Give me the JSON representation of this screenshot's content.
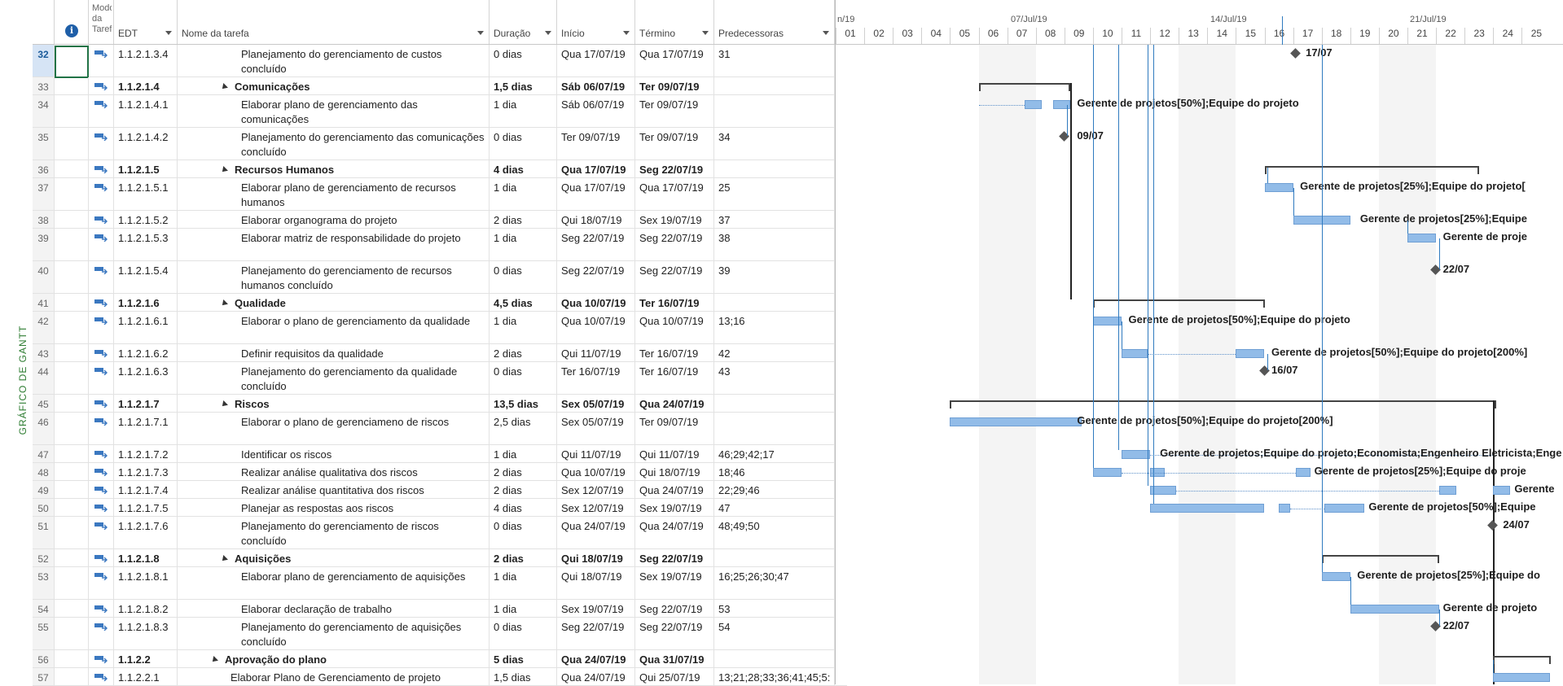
{
  "side_label": "GRÁFICO DE GANTT",
  "columns": {
    "info": "i",
    "mode": "Modo da Tarefa",
    "edt": "EDT",
    "name": "Nome da tarefa",
    "duration": "Duração",
    "start": "Início",
    "finish": "Término",
    "pred": "Predecessoras"
  },
  "rows": [
    {
      "id": "32",
      "edt": "1.1.2.1.3.4",
      "name": "Planejamento do gerenciamento de custos concluído",
      "dur": "0 dias",
      "start": "Qua 17/07/19",
      "finish": "Qua 17/07/19",
      "pred": "31",
      "summary": false,
      "selected": true
    },
    {
      "id": "33",
      "edt": "1.1.2.1.4",
      "name": "Comunicações",
      "dur": "1,5 dias",
      "start": "Sáb 06/07/19",
      "finish": "Ter 09/07/19",
      "pred": "",
      "summary": true
    },
    {
      "id": "34",
      "edt": "1.1.2.1.4.1",
      "name": "Elaborar plano de gerenciamento das comunicações",
      "dur": "1 dia",
      "start": "Sáb 06/07/19",
      "finish": "Ter 09/07/19",
      "pred": "",
      "summary": false
    },
    {
      "id": "35",
      "edt": "1.1.2.1.4.2",
      "name": "Planejamento do gerenciamento das comunicações concluído",
      "dur": "0 dias",
      "start": "Ter 09/07/19",
      "finish": "Ter 09/07/19",
      "pred": "34",
      "summary": false
    },
    {
      "id": "36",
      "edt": "1.1.2.1.5",
      "name": "Recursos Humanos",
      "dur": "4 dias",
      "start": "Qua 17/07/19",
      "finish": "Seg 22/07/19",
      "pred": "",
      "summary": true
    },
    {
      "id": "37",
      "edt": "1.1.2.1.5.1",
      "name": "Elaborar plano de gerenciamento de recursos humanos",
      "dur": "1 dia",
      "start": "Qua 17/07/19",
      "finish": "Qua 17/07/19",
      "pred": "25",
      "summary": false
    },
    {
      "id": "38",
      "edt": "1.1.2.1.5.2",
      "name": "Elaborar organograma do projeto",
      "dur": "2 dias",
      "start": "Qui 18/07/19",
      "finish": "Sex 19/07/19",
      "pred": "37",
      "summary": false
    },
    {
      "id": "39",
      "edt": "1.1.2.1.5.3",
      "name": "Elaborar matriz de responsabilidade do projeto",
      "dur": "1 dia",
      "start": "Seg 22/07/19",
      "finish": "Seg 22/07/19",
      "pred": "38",
      "summary": false
    },
    {
      "id": "40",
      "edt": "1.1.2.1.5.4",
      "name": "Planejamento do gerenciamento de recursos humanos concluído",
      "dur": "0 dias",
      "start": "Seg 22/07/19",
      "finish": "Seg 22/07/19",
      "pred": "39",
      "summary": false
    },
    {
      "id": "41",
      "edt": "1.1.2.1.6",
      "name": "Qualidade",
      "dur": "4,5 dias",
      "start": "Qua 10/07/19",
      "finish": "Ter 16/07/19",
      "pred": "",
      "summary": true
    },
    {
      "id": "42",
      "edt": "1.1.2.1.6.1",
      "name": "Elaborar o plano de gerenciamento da qualidade",
      "dur": "1 dia",
      "start": "Qua 10/07/19",
      "finish": "Qua 10/07/19",
      "pred": "13;16",
      "summary": false
    },
    {
      "id": "43",
      "edt": "1.1.2.1.6.2",
      "name": "Definir requisitos da qualidade",
      "dur": "2 dias",
      "start": "Qui 11/07/19",
      "finish": "Ter 16/07/19",
      "pred": "42",
      "summary": false
    },
    {
      "id": "44",
      "edt": "1.1.2.1.6.3",
      "name": "Planejamento do gerenciamento da qualidade concluído",
      "dur": "0 dias",
      "start": "Ter 16/07/19",
      "finish": "Ter 16/07/19",
      "pred": "43",
      "summary": false
    },
    {
      "id": "45",
      "edt": "1.1.2.1.7",
      "name": "Riscos",
      "dur": "13,5 dias",
      "start": "Sex 05/07/19",
      "finish": "Qua 24/07/19",
      "pred": "",
      "summary": true
    },
    {
      "id": "46",
      "edt": "1.1.2.1.7.1",
      "name": "Elaborar o plano de gerenciameno de riscos",
      "dur": "2,5 dias",
      "start": "Sex 05/07/19",
      "finish": "Ter 09/07/19",
      "pred": "",
      "summary": false
    },
    {
      "id": "47",
      "edt": "1.1.2.1.7.2",
      "name": "Identificar os riscos",
      "dur": "1 dia",
      "start": "Qui 11/07/19",
      "finish": "Qui 11/07/19",
      "pred": "46;29;42;17",
      "summary": false
    },
    {
      "id": "48",
      "edt": "1.1.2.1.7.3",
      "name": "Realizar análise qualitativa dos riscos",
      "dur": "2 dias",
      "start": "Qua 10/07/19",
      "finish": "Qui 18/07/19",
      "pred": "18;46",
      "summary": false
    },
    {
      "id": "49",
      "edt": "1.1.2.1.7.4",
      "name": "Realizar análise quantitativa dos riscos",
      "dur": "2 dias",
      "start": "Sex 12/07/19",
      "finish": "Qua 24/07/19",
      "pred": "22;29;46",
      "summary": false
    },
    {
      "id": "50",
      "edt": "1.1.2.1.7.5",
      "name": "Planejar as respostas aos riscos",
      "dur": "4 dias",
      "start": "Sex 12/07/19",
      "finish": "Sex 19/07/19",
      "pred": "47",
      "summary": false
    },
    {
      "id": "51",
      "edt": "1.1.2.1.7.6",
      "name": "Planejamento do gerenciamento de riscos concluído",
      "dur": "0 dias",
      "start": "Qua 24/07/19",
      "finish": "Qua 24/07/19",
      "pred": "48;49;50",
      "summary": false
    },
    {
      "id": "52",
      "edt": "1.1.2.1.8",
      "name": "Aquisições",
      "dur": "2 dias",
      "start": "Qui 18/07/19",
      "finish": "Seg 22/07/19",
      "pred": "",
      "summary": true
    },
    {
      "id": "53",
      "edt": "1.1.2.1.8.1",
      "name": "Elaborar plano de gerenciamento de aquisições",
      "dur": "1 dia",
      "start": "Qui 18/07/19",
      "finish": "Sex 19/07/19",
      "pred": "16;25;26;30;47",
      "summary": false
    },
    {
      "id": "54",
      "edt": "1.1.2.1.8.2",
      "name": "Elaborar declaração de trabalho",
      "dur": "1 dia",
      "start": "Sex 19/07/19",
      "finish": "Seg 22/07/19",
      "pred": "53",
      "summary": false
    },
    {
      "id": "55",
      "edt": "1.1.2.1.8.3",
      "name": "Planejamento do gerenciamento de aquisições concluído",
      "dur": "0 dias",
      "start": "Seg 22/07/19",
      "finish": "Seg 22/07/19",
      "pred": "54",
      "summary": false
    },
    {
      "id": "56",
      "edt": "1.1.2.2",
      "name": "Aprovação do plano",
      "dur": "5 dias",
      "start": "Qua 24/07/19",
      "finish": "Qua 31/07/19",
      "pred": "",
      "summary": true
    },
    {
      "id": "57",
      "edt": "1.1.2.2.1",
      "name": "Elaborar Plano de Gerenciamento de projeto",
      "dur": "1,5 dias",
      "start": "Qua 24/07/19",
      "finish": "Qui 25/07/19",
      "pred": "13;21;28;33;36;41;45;5:",
      "summary": false
    }
  ],
  "timeline": {
    "weeks": [
      "n/19",
      "07/Jul/19",
      "14/Jul/19",
      "21/Jul/19"
    ],
    "days": [
      "01",
      "02",
      "03",
      "04",
      "05",
      "06",
      "07",
      "08",
      "09",
      "10",
      "11",
      "12",
      "13",
      "14",
      "15",
      "16",
      "17",
      "18",
      "19",
      "20",
      "21",
      "22",
      "23",
      "24",
      "25"
    ]
  },
  "gantt_labels": {
    "r32": "17/07",
    "r34": "Gerente de projetos[50%];Equipe do projeto",
    "r35": "09/07",
    "r37": "Gerente de projetos[25%];Equipe do projeto[",
    "r38": "Gerente de projetos[25%];Equipe",
    "r39": "Gerente de proje",
    "r40": "22/07",
    "r42": "Gerente de projetos[50%];Equipe do projeto",
    "r43": "Gerente de projetos[50%];Equipe do projeto[200%]",
    "r44": "16/07",
    "r46": "Gerente de projetos[50%];Equipe do projeto[200%]",
    "r47": "Gerente de projetos;Equipe do projeto;Economista;Engenheiro Eletricista;Enge",
    "r48": "Gerente de projetos[25%];Equipe do proje",
    "r49": "Gerente",
    "r50": "Gerente de projetos[50%];Equipe",
    "r51": "24/07",
    "r53": "Gerente de projetos[25%];Equipe do",
    "r54": "Gerente de projeto",
    "r55": "22/07"
  },
  "colors": {
    "bar": "#92bce8",
    "link": "#2f7abf",
    "summary": "#444444",
    "side_label": "#2e7d32"
  }
}
